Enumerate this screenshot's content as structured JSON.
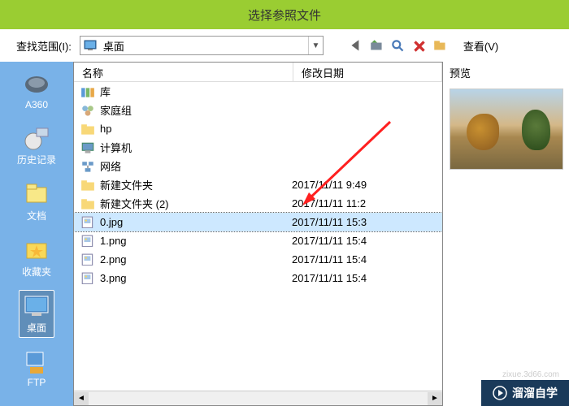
{
  "title": "选择参照文件",
  "toolbar": {
    "scope_label": "查找范围(I):",
    "dropdown_text": "桌面",
    "view_label": "查看(V)"
  },
  "headers": {
    "name": "名称",
    "date": "修改日期"
  },
  "preview": {
    "label": "预览"
  },
  "sidebar": [
    {
      "id": "a360",
      "label": "A360"
    },
    {
      "id": "history",
      "label": "历史记录"
    },
    {
      "id": "documents",
      "label": "文档"
    },
    {
      "id": "favorites",
      "label": "收藏夹"
    },
    {
      "id": "desktop",
      "label": "桌面"
    },
    {
      "id": "ftp",
      "label": "FTP"
    }
  ],
  "files": [
    {
      "icon": "library",
      "name": "库",
      "date": ""
    },
    {
      "icon": "homegroup",
      "name": "家庭组",
      "date": ""
    },
    {
      "icon": "folder",
      "name": "hp",
      "date": ""
    },
    {
      "icon": "computer",
      "name": "计算机",
      "date": ""
    },
    {
      "icon": "network",
      "name": "网络",
      "date": ""
    },
    {
      "icon": "folder",
      "name": "新建文件夹",
      "date": "2017/11/11 9:49"
    },
    {
      "icon": "folder",
      "name": "新建文件夹 (2)",
      "date": "2017/11/11 11:2"
    },
    {
      "icon": "image",
      "name": "0.jpg",
      "date": "2017/11/11 15:3",
      "selected": true
    },
    {
      "icon": "image",
      "name": "1.png",
      "date": "2017/11/11 15:4"
    },
    {
      "icon": "image",
      "name": "2.png",
      "date": "2017/11/11 15:4"
    },
    {
      "icon": "image",
      "name": "3.png",
      "date": "2017/11/11 15:4"
    }
  ],
  "watermark": {
    "text": "溜溜自学",
    "sub": "zixue.3d66.com"
  }
}
